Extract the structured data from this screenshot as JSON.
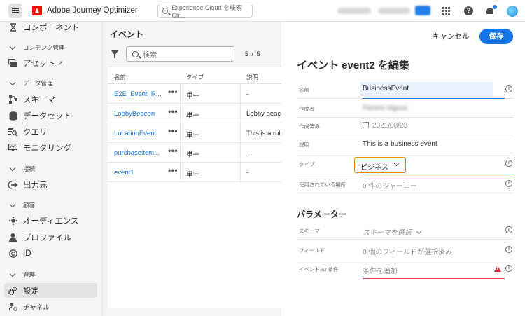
{
  "header": {
    "app_title": "Adobe Journey Optimizer",
    "search_placeholder": "Experience Cloud を検索 Ctr...",
    "icons": [
      "menu-icon",
      "adobe-logo-icon",
      "search-icon",
      "apps-grid-icon",
      "help-icon",
      "bell-icon",
      "avatar"
    ]
  },
  "sidebar": {
    "items": [
      {
        "label": "コンポーネント",
        "icon": "components-icon"
      },
      {
        "label": "コンテンツ管理",
        "type": "section"
      },
      {
        "label": "アセット",
        "icon": "assets-icon",
        "external": true
      },
      {
        "label": "データ管理",
        "type": "section"
      },
      {
        "label": "スキーマ",
        "icon": "schema-icon"
      },
      {
        "label": "データセット",
        "icon": "dataset-icon"
      },
      {
        "label": "クエリ",
        "icon": "query-icon"
      },
      {
        "label": "モニタリング",
        "icon": "monitoring-icon"
      },
      {
        "label": "接続",
        "type": "section"
      },
      {
        "label": "出力元",
        "icon": "sources-icon"
      },
      {
        "label": "顧客",
        "type": "section"
      },
      {
        "label": "オーディエンス",
        "icon": "audience-icon"
      },
      {
        "label": "プロファイル",
        "icon": "profile-icon"
      },
      {
        "label": "ID",
        "icon": "identity-icon"
      },
      {
        "label": "管理",
        "type": "section"
      },
      {
        "label": "設定",
        "icon": "settings-icon",
        "active": true
      },
      {
        "label": "チャネル",
        "icon": "channel-icon"
      }
    ]
  },
  "events_list": {
    "title": "イベント",
    "search_placeholder": "検索",
    "count": "5 / 5",
    "columns": [
      "名前",
      "タイプ",
      "説明"
    ],
    "rows": [
      {
        "name": "E2E_Event_R...",
        "type": "単一",
        "description": "-"
      },
      {
        "name": "LobbyBeacon",
        "type": "単一",
        "description": "Lobby beacon"
      },
      {
        "name": "LocationEvent",
        "type": "単一",
        "description": "This is a rule-b"
      },
      {
        "name": "purchaseitem...",
        "type": "単一",
        "description": "-"
      },
      {
        "name": "event1",
        "type": "単一",
        "description": "-"
      }
    ]
  },
  "edit_panel": {
    "cancel_label": "キャンセル",
    "save_label": "保存",
    "title": "イベント event2 を編集",
    "fields": {
      "name": {
        "label": "名前",
        "value": "BusinessEvent"
      },
      "author": {
        "label": "作成者",
        "value": "Florent Vigoux"
      },
      "created": {
        "label": "作成済み",
        "value": "2021/08/23"
      },
      "description": {
        "label": "説明",
        "value": "This is a business event"
      },
      "type": {
        "label": "タイプ",
        "value": "ビジネス"
      },
      "used_in": {
        "label": "使用されている場所",
        "value": "0 件のジャーニー"
      }
    },
    "parameters_title": "パラメーター",
    "parameters": {
      "schema": {
        "label": "スキーマ",
        "placeholder": "スキーマを選択"
      },
      "fields": {
        "label": "フィールド",
        "value": "0 個のフィールドが選択済み"
      },
      "event_id": {
        "label": "イベント ID 条件",
        "placeholder": "条件を追加"
      }
    },
    "colors": {
      "accent": "#1473e6",
      "warning": "#e68619",
      "error": "#e34850"
    }
  }
}
